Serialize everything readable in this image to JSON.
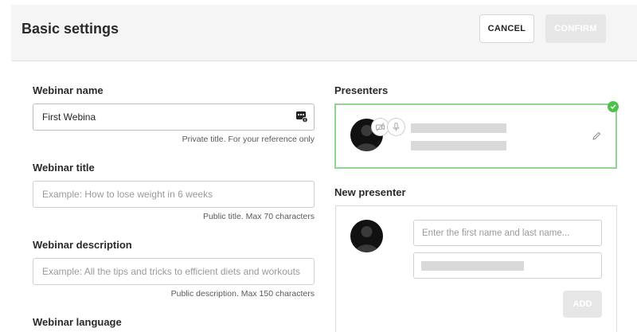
{
  "header": {
    "title": "Basic settings",
    "cancel_label": "CANCEL",
    "confirm_label": "CONFIRM"
  },
  "webinar_name": {
    "label": "Webinar name",
    "value": "First Webina",
    "hint": "Private title. For your reference only"
  },
  "webinar_title": {
    "label": "Webinar title",
    "placeholder": "Example: How to lose weight in 6 weeks",
    "hint": "Public title. Max 70 characters"
  },
  "webinar_description": {
    "label": "Webinar description",
    "placeholder": "Example: All the tips and tricks to efficient diets and workouts",
    "hint": "Public description. Max 150 characters"
  },
  "webinar_language": {
    "label": "Webinar language"
  },
  "presenters": {
    "label": "Presenters",
    "icons": [
      "avatar",
      "camera-off-icon",
      "microphone-icon",
      "pencil-icon",
      "check-icon"
    ],
    "accent_color": "#8fd48f",
    "check_color": "#4cc24c"
  },
  "new_presenter": {
    "label": "New presenter",
    "name_placeholder": "Enter the first name and last name...",
    "add_label": "ADD"
  }
}
